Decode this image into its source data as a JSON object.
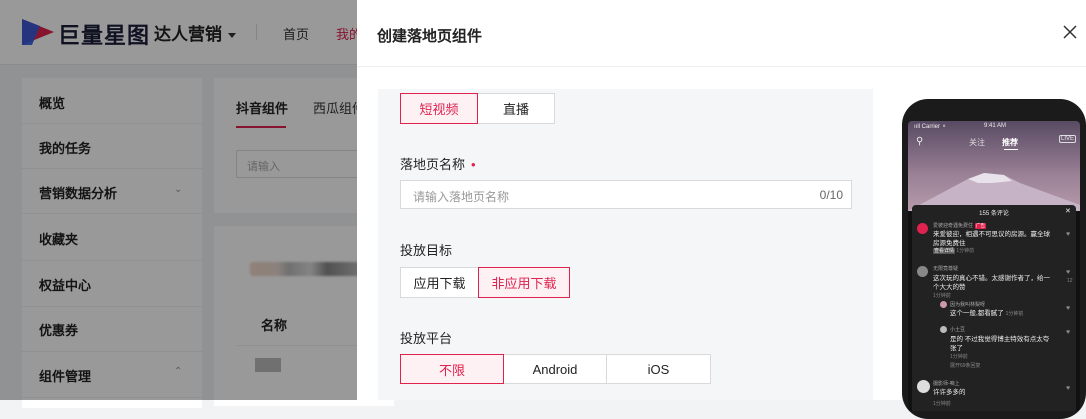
{
  "app": {
    "logo_text": "巨量星图",
    "app_selector": "达人营销",
    "nav": [
      "首页",
      "我的"
    ]
  },
  "sidebar": {
    "items": [
      {
        "label": "概览"
      },
      {
        "label": "我的任务"
      },
      {
        "label": "营销数据分析"
      },
      {
        "label": "收藏夹"
      },
      {
        "label": "权益中心"
      },
      {
        "label": "优惠券"
      },
      {
        "label": "组件管理"
      }
    ]
  },
  "content": {
    "tabs": [
      "抖音组件",
      "西瓜组件"
    ],
    "search_placeholder": "请输入",
    "column_name": "名称"
  },
  "drawer": {
    "title": "创建落地页组件",
    "video_types": [
      {
        "label": "短视频",
        "selected": true
      },
      {
        "label": "直播",
        "selected": false
      }
    ],
    "name_field": {
      "label": "落地页名称",
      "required_mark": "•",
      "placeholder": "请输入落地页名称",
      "counter": "0/10"
    },
    "goal_field": {
      "label": "投放目标",
      "options": [
        {
          "label": "应用下载",
          "selected": false
        },
        {
          "label": "非应用下载",
          "selected": true
        }
      ]
    },
    "platform_field": {
      "label": "投放平台",
      "options": [
        {
          "label": "不限",
          "selected": true
        },
        {
          "label": "Android",
          "selected": false
        },
        {
          "label": "iOS",
          "selected": false
        }
      ]
    }
  },
  "phone": {
    "carrier": "ııll Carrier ⚬",
    "time": "9:41 AM",
    "tabs": [
      "关注",
      "推荐"
    ],
    "live": "LIVE",
    "comments_title": "155 条评论",
    "comments": [
      {
        "name": "爱彼迎奇遇免费住",
        "tag": "广告",
        "text": "来爱彼迎，相遇不可思议的房源。赢全球房源免费住",
        "time": "1分钟前",
        "link": "查看详情"
      },
      {
        "name": "无限竟尊疑",
        "text": "这次玩的真心不错。太感谢作者了，给一个大大的赞",
        "time": "1分钟前",
        "likes": "12"
      },
      {
        "name": "因为我叫林梨呀",
        "text": "这个一般,都看腻了",
        "time": "1分钟前"
      },
      {
        "name": "小土豆",
        "text": "是的 不过我觉得博主特效有点太夸张了",
        "time": "1分钟前",
        "more": "展开69条回复"
      },
      {
        "name": "摄影师-咱上",
        "text": "许许多多的",
        "time": "1分钟前"
      }
    ]
  }
}
